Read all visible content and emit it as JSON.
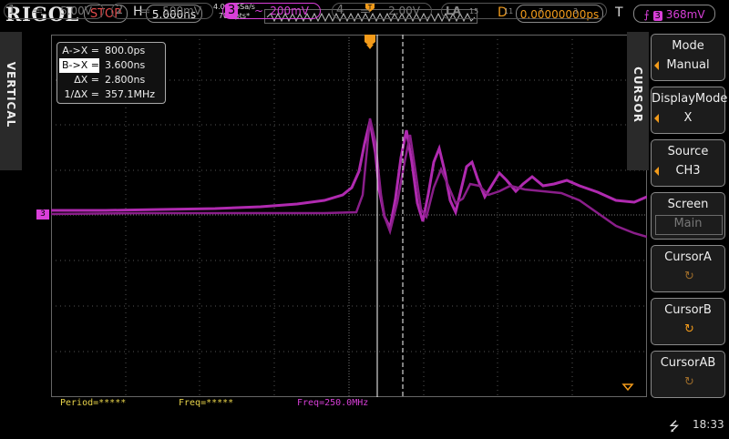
{
  "header": {
    "logo": "RIGOL",
    "run_state": "STOP",
    "h_label": "H",
    "timebase": "5.000ns",
    "sample_rate": "4.000GSa/s",
    "memory_depth": "700 pts*",
    "d_label": "D",
    "delay": "0.00000000ps",
    "t_label": "T",
    "trigger_channel": "3",
    "trigger_level": "368mV"
  },
  "left_tab": {
    "label": "VERTICAL"
  },
  "cursor_readout": {
    "rows": [
      {
        "label": "A->X =",
        "value": "800.0ps"
      },
      {
        "label": "B->X =",
        "value": "3.600ns"
      },
      {
        "label": "ΔX =",
        "value": "2.800ns"
      },
      {
        "label": "1/ΔX =",
        "value": "357.1MHz"
      }
    ]
  },
  "channel_marker": "3",
  "measurements": {
    "period": "Period=*****",
    "freq": "Freq=*****",
    "freq3": "Freq=250.0MHz"
  },
  "right_panel": {
    "tab_label": "CURSOR",
    "mode": {
      "title": "Mode",
      "value": "Manual"
    },
    "display_mode": {
      "title": "DisplayMode",
      "value": "X"
    },
    "source": {
      "title": "Source",
      "value": "CH3"
    },
    "screen": {
      "title": "Screen",
      "value": "Main"
    },
    "cursor_a": {
      "title": "CursorA"
    },
    "cursor_b": {
      "title": "CursorB"
    },
    "cursor_ab": {
      "title": "CursorAB"
    }
  },
  "channels": [
    {
      "num": "1",
      "coupling": "≕",
      "scale": "5.00V",
      "color": "#777777",
      "active": false
    },
    {
      "num": "2",
      "coupling": "≕",
      "scale": "500mV",
      "color": "#777777",
      "active": false
    },
    {
      "num": "3",
      "coupling": "~",
      "scale": "200mV",
      "color": "#d83fd8",
      "active": true
    },
    {
      "num": "4",
      "coupling": "≕",
      "scale": "2.00V",
      "color": "#777777",
      "active": false
    }
  ],
  "la": {
    "label": "LA",
    "ticks": [
      "15",
      "11",
      "7",
      "3"
    ]
  },
  "clock": "18:33",
  "colors": {
    "accent": "#f39b1a",
    "trace": "#c02ac0",
    "stop": "#e24c4c"
  }
}
